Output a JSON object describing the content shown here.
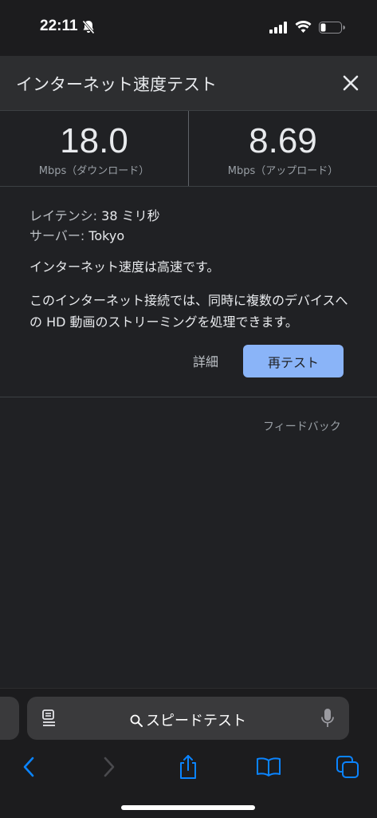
{
  "status_bar": {
    "time": "22:11"
  },
  "header": {
    "title": "インターネット速度テスト"
  },
  "speeds": {
    "download": {
      "value": "18.0",
      "unit": "Mbps（ダウンロード）"
    },
    "upload": {
      "value": "8.69",
      "unit": "Mbps（アップロード）"
    }
  },
  "details": {
    "latency_label": "レイテンシ:",
    "latency_value": "38 ミリ秒",
    "server_label": "サーバー:",
    "server_value": "Tokyo",
    "summary": "インターネット速度は高速です。",
    "description": "このインターネット接続では、同時に複数のデバイスへの HD 動画のストリーミングを処理できます。"
  },
  "actions": {
    "details_label": "詳細",
    "retest_label": "再テスト"
  },
  "feedback_label": "フィードバック",
  "safari": {
    "address_text": "スピードテスト"
  },
  "colors": {
    "accent": "#8ab4f8",
    "background": "#202124",
    "link_blue": "#0a84ff"
  }
}
